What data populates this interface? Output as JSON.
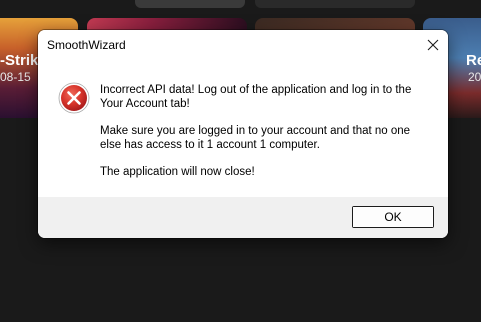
{
  "background_app": {
    "left_card_title": "-Strik",
    "left_card_date": "08-15",
    "right_card_title": "Re",
    "right_card_date": "20"
  },
  "dialog": {
    "title": "SmoothWizard",
    "icon": "error-icon",
    "message_paragraphs": [
      "Incorrect API data! Log out of the application and log in to the Your Account tab!",
      "Make sure you are logged in to your account and that no one else has access to it 1 account 1 computer.",
      "The application will now close!"
    ],
    "ok_label": "OK",
    "colors": {
      "error_red": "#c42b1c",
      "footer_bg": "#f0f0f0"
    }
  }
}
